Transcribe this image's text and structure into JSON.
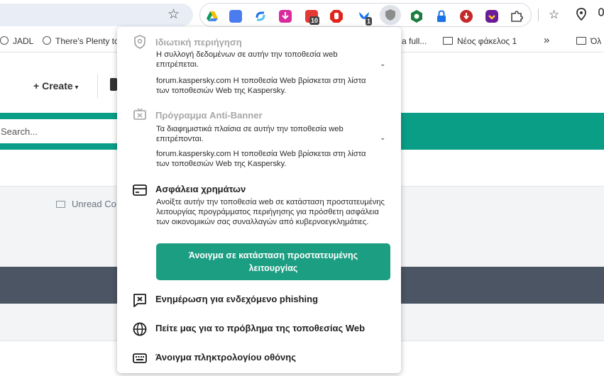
{
  "bookmarks": [
    {
      "label": "JADL",
      "icon": "globe-icon"
    },
    {
      "label": "There's Plenty to",
      "icon": "globe-icon"
    },
    {
      "label": "a full...",
      "icon": ""
    },
    {
      "label": "Νέος φάκελος 1",
      "icon": "folder-icon"
    },
    {
      "label": "»",
      "icon": ""
    },
    {
      "label": "Όλ",
      "icon": "folder-icon"
    }
  ],
  "extension_badges": {
    "ext6": "10",
    "ext8": "1"
  },
  "page": {
    "create_label": "Create",
    "search_placeholder": "Search...",
    "unread_label": "Unread Co"
  },
  "popup": {
    "private_browsing": {
      "title": "Ιδιωτική περιήγηση",
      "status": "Η συλλογή δεδομένων σε αυτήν την τοποθεσία web επιτρέπεται.",
      "note": "forum.kaspersky.com Η τοποθεσία Web βρίσκεται στη λίστα των τοποθεσιών Web της Kaspersky."
    },
    "anti_banner": {
      "title": "Πρόγραμμα Anti-Banner",
      "status": "Τα διαφημιστικά πλαίσια σε αυτήν την τοποθεσία web επιτρέπονται.",
      "note": "forum.kaspersky.com Η τοποθεσία Web βρίσκεται στη λίστα των τοποθεσιών Web της Kaspersky."
    },
    "safe_money": {
      "title": "Ασφάλεια χρημάτων",
      "description": "Ανοίξτε αυτήν την τοποθεσία web σε κατάσταση προστατευμένης λειτουργίας προγράμματος περιήγησης για πρόσθετη ασφάλεια των οικονομικών σας συναλλαγών από κυβερνοεγκλημάτιες.",
      "button_label": "Άνοιγμα σε κατάσταση προστατευμένης λειτουργίας"
    },
    "menu": {
      "phishing": "Ενημέρωση για ενδεχόμενο phishing",
      "report": "Πείτε μας για το πρόβλημα της τοποθεσίας Web",
      "keyboard": "Άνοιγμα πληκτρολογίου οθόνης"
    }
  }
}
